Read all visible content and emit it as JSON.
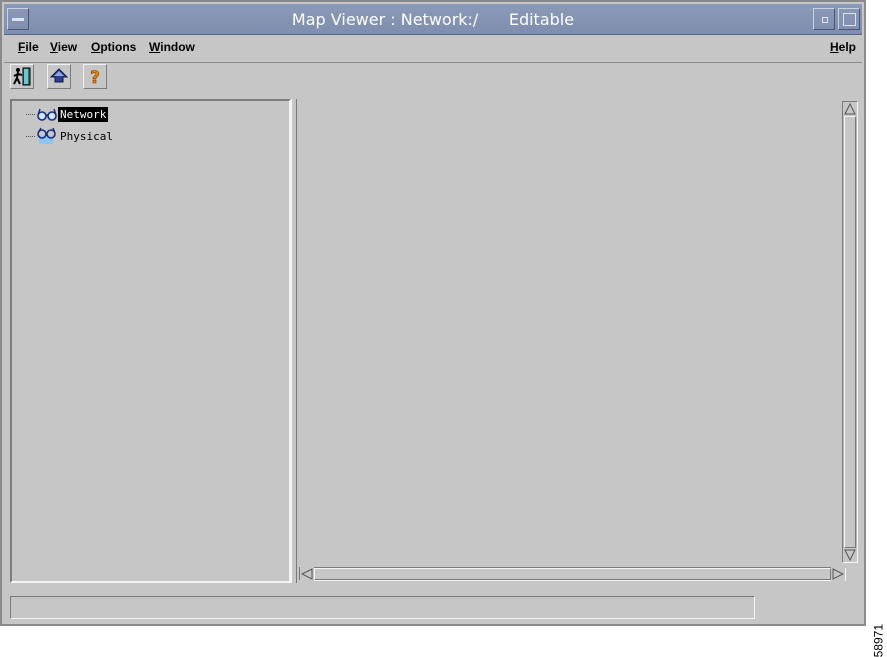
{
  "window": {
    "title": "Map Viewer : Network:/      Editable"
  },
  "menubar": {
    "file": {
      "underline": "F",
      "rest": "ile"
    },
    "view": {
      "underline": "V",
      "rest": "iew"
    },
    "options": {
      "underline": "O",
      "rest": "ptions"
    },
    "window": {
      "underline": "W",
      "rest": "indow"
    },
    "help": {
      "underline": "H",
      "rest": "elp"
    }
  },
  "toolbar": {
    "items": [
      {
        "icon": "exit-door-icon"
      },
      {
        "icon": "up-level-icon"
      },
      {
        "icon": "help-question-icon"
      }
    ]
  },
  "tree": {
    "items": [
      {
        "label": "Network",
        "icon": "network-glasses-icon",
        "selected": true
      },
      {
        "label": "Physical",
        "icon": "physical-view-icon",
        "selected": false
      }
    ]
  },
  "statusbar": {
    "text": ""
  },
  "figure_id": "58971",
  "colors": {
    "titlebar": "#8b9ab8",
    "panel": "#c6c6c6",
    "selection": "#000000"
  }
}
